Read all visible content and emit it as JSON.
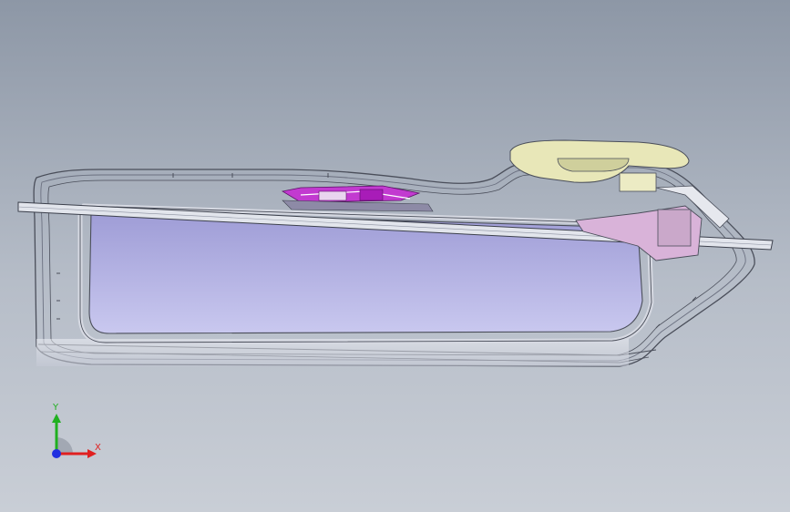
{
  "viewport": {
    "background_top": "#8d97a6",
    "background_bottom": "#c9ced6"
  },
  "model": {
    "frame_color": "#d9dde6",
    "edge_color": "#4a4e5a",
    "panel_color": "#b9b8e6",
    "handle_color": "#e8e7b8",
    "bracket_color": "#b400c8",
    "latch_color": "#d9b3d9"
  },
  "triad": {
    "x_label": "X",
    "y_label": "Y",
    "x_color": "#e02020",
    "y_color": "#20b020",
    "z_color": "#2030e0"
  }
}
